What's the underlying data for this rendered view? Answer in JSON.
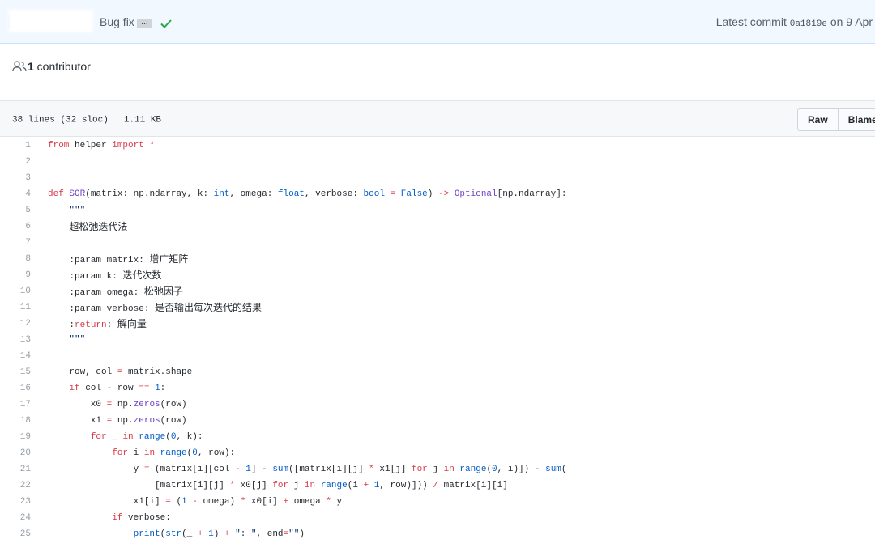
{
  "commit_bar": {
    "message": "Bug fix",
    "ellipsis": "…",
    "latest_prefix": "Latest commit ",
    "sha": "0a1819e",
    "date_suffix": " on 9 Apr"
  },
  "contributors": {
    "count": "1",
    "label": " contributor"
  },
  "file_header": {
    "lines_info": "38 lines (32 sloc)",
    "size": "1.11 KB",
    "raw_label": "Raw",
    "blame_label": "Blame"
  },
  "code_lines": [
    {
      "n": "1",
      "t": "from helper import *"
    },
    {
      "n": "2",
      "t": ""
    },
    {
      "n": "3",
      "t": ""
    },
    {
      "n": "4",
      "t": "def SOR(matrix: np.ndarray, k: int, omega: float, verbose: bool = False) -> Optional[np.ndarray]:"
    },
    {
      "n": "5",
      "t": "    \"\"\""
    },
    {
      "n": "6",
      "t": "    超松弛迭代法"
    },
    {
      "n": "7",
      "t": ""
    },
    {
      "n": "8",
      "t": "    :param matrix: 增广矩阵"
    },
    {
      "n": "9",
      "t": "    :param k: 迭代次数"
    },
    {
      "n": "10",
      "t": "    :param omega: 松弛因子"
    },
    {
      "n": "11",
      "t": "    :param verbose: 是否输出每次迭代的结果"
    },
    {
      "n": "12",
      "t": "    :return: 解向量"
    },
    {
      "n": "13",
      "t": "    \"\"\""
    },
    {
      "n": "14",
      "t": ""
    },
    {
      "n": "15",
      "t": "    row, col = matrix.shape"
    },
    {
      "n": "16",
      "t": "    if col - row == 1:"
    },
    {
      "n": "17",
      "t": "        x0 = np.zeros(row)"
    },
    {
      "n": "18",
      "t": "        x1 = np.zeros(row)"
    },
    {
      "n": "19",
      "t": "        for _ in range(0, k):"
    },
    {
      "n": "20",
      "t": "            for i in range(0, row):"
    },
    {
      "n": "21",
      "t": "                y = (matrix[i][col - 1] - sum([matrix[i][j] * x1[j] for j in range(0, i)]) - sum("
    },
    {
      "n": "22",
      "t": "                    [matrix[i][j] * x0[j] for j in range(i + 1, row)])) / matrix[i][i]"
    },
    {
      "n": "23",
      "t": "                x1[i] = (1 - omega) * x0[i] + omega * y"
    },
    {
      "n": "24",
      "t": "            if verbose:"
    },
    {
      "n": "25",
      "t": "                print(str(_ + 1) + \": \", end=\"\")"
    }
  ]
}
